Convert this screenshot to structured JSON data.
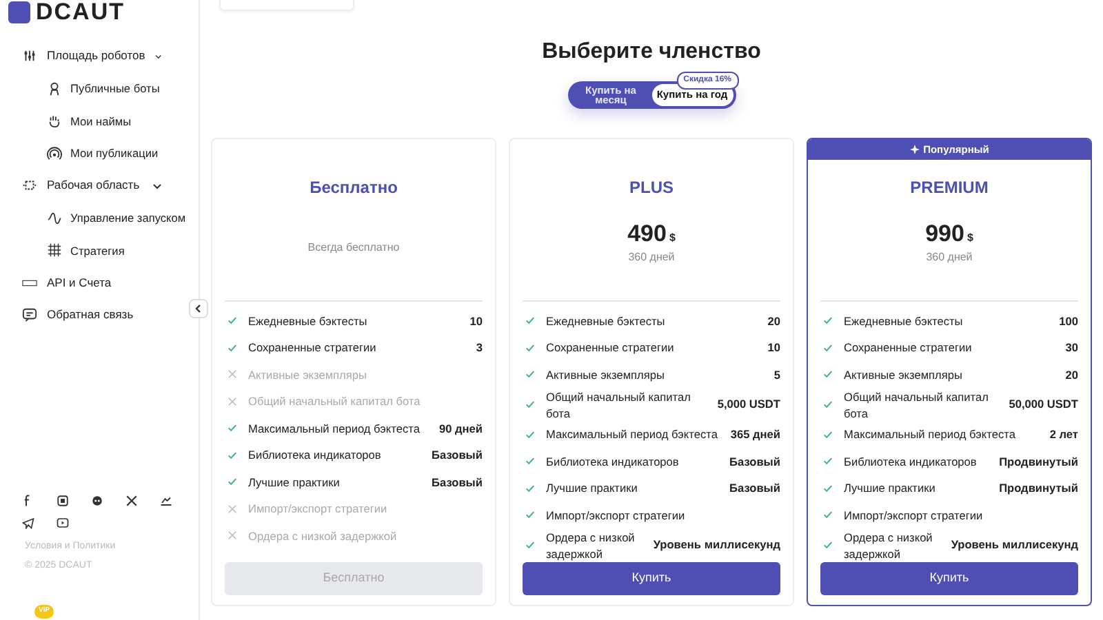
{
  "logo": {
    "text": "DCAUT"
  },
  "sidebar": {
    "items": [
      {
        "label": "Площадь роботов",
        "expanded": true,
        "children": [
          {
            "label": "Публичные боты"
          },
          {
            "label": "Мои наймы"
          },
          {
            "label": "Мои публикации"
          }
        ]
      },
      {
        "label": "Рабочая область",
        "expanded": true,
        "children": [
          {
            "label": "Управление запуском"
          },
          {
            "label": "Стратегия"
          }
        ]
      },
      {
        "label": "API и Счета"
      },
      {
        "label": "Обратная связь"
      }
    ],
    "footer_link": "Условия и Политики",
    "copyright": "© 2025 DCAUT",
    "vip_badge": "VIP"
  },
  "title": "Выберите членство",
  "billing_toggle": {
    "options": [
      {
        "label": "Купить на месяц",
        "selected": false
      },
      {
        "label": "Купить на год",
        "selected": true
      }
    ],
    "discount_badge": "Скидка 16%"
  },
  "plans": [
    {
      "name": "Бесплатно",
      "description": "Всегда бесплатно",
      "popular": false,
      "features": [
        {
          "label": "Ежедневные бэктесты",
          "value": "10",
          "included": true
        },
        {
          "label": "Сохраненные стратегии",
          "value": "3",
          "included": true
        },
        {
          "label": "Активные экземпляры",
          "included": false
        },
        {
          "label": "Общий начальный капитал бота",
          "included": false
        },
        {
          "label": "Максимальный период бэктеста",
          "value": "90 дней",
          "included": true
        },
        {
          "label": "Библиотека индикаторов",
          "value": "Базовый",
          "included": true
        },
        {
          "label": "Лучшие практики",
          "value": "Базовый",
          "included": true
        },
        {
          "label": "Импорт/экспорт стратегии",
          "included": false
        },
        {
          "label": "Ордера с низкой задержкой",
          "included": false
        }
      ],
      "button": {
        "label": "Бесплатно",
        "disabled": true
      }
    },
    {
      "name": "PLUS",
      "price": "490",
      "currency": "$",
      "period": "360 дней",
      "popular": false,
      "features": [
        {
          "label": "Ежедневные бэктесты",
          "value": "20",
          "included": true
        },
        {
          "label": "Сохраненные стратегии",
          "value": "10",
          "included": true
        },
        {
          "label": "Активные экземпляры",
          "value": "5",
          "included": true
        },
        {
          "label": "Общий начальный капитал бота",
          "value": "5,000 USDT",
          "included": true
        },
        {
          "label": "Максимальный период бэктеста",
          "value": "365 дней",
          "included": true
        },
        {
          "label": "Библиотека индикаторов",
          "value": "Базовый",
          "included": true
        },
        {
          "label": "Лучшие практики",
          "value": "Базовый",
          "included": true
        },
        {
          "label": "Импорт/экспорт стратегии",
          "included": true
        },
        {
          "label": "Ордера с низкой задержкой",
          "value": "Уровень миллисекунд",
          "included": true
        }
      ],
      "button": {
        "label": "Купить",
        "disabled": false
      }
    },
    {
      "name": "PREMIUM",
      "price": "990",
      "currency": "$",
      "period": "360 дней",
      "popular": true,
      "popular_label": "Популярный",
      "features": [
        {
          "label": "Ежедневные бэктесты",
          "value": "100",
          "included": true
        },
        {
          "label": "Сохраненные стратегии",
          "value": "30",
          "included": true
        },
        {
          "label": "Активные экземпляры",
          "value": "20",
          "included": true
        },
        {
          "label": "Общий начальный капитал бота",
          "value": "50,000 USDT",
          "included": true
        },
        {
          "label": "Максимальный период бэктеста",
          "value": "2 лет",
          "included": true
        },
        {
          "label": "Библиотека индикаторов",
          "value": "Продвинутый",
          "included": true
        },
        {
          "label": "Лучшие практики",
          "value": "Продвинутый",
          "included": true
        },
        {
          "label": "Импорт/экспорт стратегии",
          "included": true
        },
        {
          "label": "Ордера с низкой задержкой",
          "value": "Уровень миллисекунд",
          "included": true
        }
      ],
      "button": {
        "label": "Купить",
        "disabled": false
      }
    }
  ]
}
